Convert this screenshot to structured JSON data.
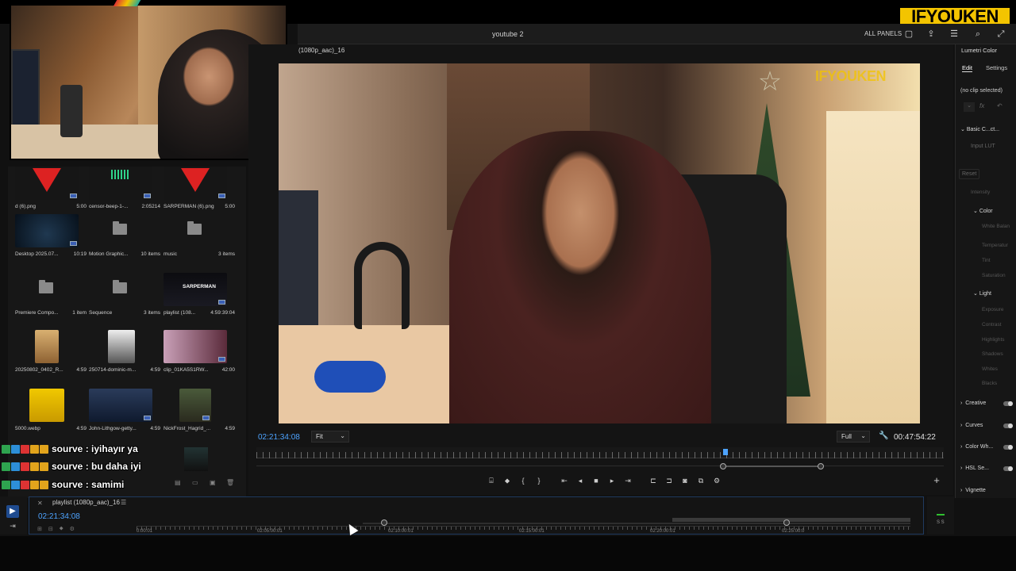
{
  "brand": {
    "label": "IFYOUKEN",
    "color": "#f3c400"
  },
  "header": {
    "project_title": "youtube 2",
    "all_panels_label": "ALL PANELS",
    "icons": [
      "panel-icon",
      "share-icon",
      "menu-icon",
      "search-icon",
      "fullscreen-icon"
    ]
  },
  "webcam": {
    "description_icon": "webcam-overlay"
  },
  "project_panel": {
    "items": [
      {
        "name": "d (6).png",
        "duration": "5:00",
        "type": "image"
      },
      {
        "name": "censor-beep-1-...",
        "duration": "2:05214",
        "type": "audio"
      },
      {
        "name": "SARPERMAN (6).png",
        "duration": "5:00",
        "type": "image"
      },
      {
        "name": "Desktop 2025.07...",
        "duration": "10:19",
        "type": "video"
      },
      {
        "name": "Motion Graphic...",
        "duration": "10 items",
        "type": "folder"
      },
      {
        "name": "music",
        "duration": "3 items",
        "type": "folder"
      },
      {
        "name": "Premiere Compo...",
        "duration": "1 item",
        "type": "folder"
      },
      {
        "name": "Sequence",
        "duration": "3 items",
        "type": "folder"
      },
      {
        "name": "playlist (108...",
        "duration": "4:59:39:04",
        "type": "sequence"
      },
      {
        "name": "20250802_0402_R...",
        "duration": "4:59",
        "type": "image"
      },
      {
        "name": "250714-dominic-m...",
        "duration": "4:59",
        "type": "image"
      },
      {
        "name": "clip_01KA5S1RW...",
        "duration": "42:00",
        "type": "video"
      },
      {
        "name": "5000.webp",
        "duration": "4:59",
        "type": "image"
      },
      {
        "name": "John-Lithgow-getty...",
        "duration": "4:59",
        "type": "image"
      },
      {
        "name": "NickFrost_Hagrid_...",
        "duration": "4:59",
        "type": "image"
      }
    ],
    "thumb_overlay_text": "SARPERMAN"
  },
  "chat": [
    {
      "user": "sourve",
      "message": "iyihayır ya"
    },
    {
      "user": "sourve",
      "message": "bu daha iyi"
    },
    {
      "user": "sourve",
      "message": "samimi"
    }
  ],
  "monitor": {
    "sequence_tab": "(1080p_aac)_16",
    "watermark": "IFYOUKEN",
    "timecode_current": "02:21:34:08",
    "fit_label": "Fit",
    "quality_label": "Full",
    "timecode_duration": "00:47:54:22",
    "transport": [
      "lift-icon",
      "marker-icon",
      "mark-in-icon",
      "mark-out-icon",
      "go-to-in-icon",
      "step-back-icon",
      "stop-icon",
      "step-forward-icon",
      "go-to-out-icon",
      "insert-icon",
      "overwrite-icon",
      "export-frame-icon",
      "compare-icon",
      "settings-icon"
    ]
  },
  "lumetri": {
    "title": "Lumetri Color",
    "tabs": [
      "Edit",
      "Settings"
    ],
    "no_clip": "(no clip selected)",
    "reset": "Reset",
    "sections": {
      "basic": "Basic C...ct...",
      "input_lut": "Input LUT",
      "intensity": "Intensity",
      "color": "Color",
      "white_balance": "White Balan",
      "temperature": "Temperatur",
      "tint": "Tint",
      "saturation": "Saturation",
      "light": "Light",
      "exposure": "Exposure",
      "contrast": "Contrast",
      "highlights": "Highlights",
      "shadows": "Shadows",
      "whites": "Whites",
      "blacks": "Blacks",
      "creative": "Creative",
      "curves": "Curves",
      "color_wheels": "Color Wh...",
      "hsl": "HSL Se...",
      "vignette": "Vignette"
    }
  },
  "timeline": {
    "tab": "playlist (1080p_aac)_16",
    "timecode": "02:21:34:08",
    "labels": [
      "0:00:01",
      "02:05:00:01",
      "02:10:00:01",
      "02:15:00:01",
      "02:20:00:01",
      "02:25:00:0"
    ],
    "meter_label": "S S"
  }
}
